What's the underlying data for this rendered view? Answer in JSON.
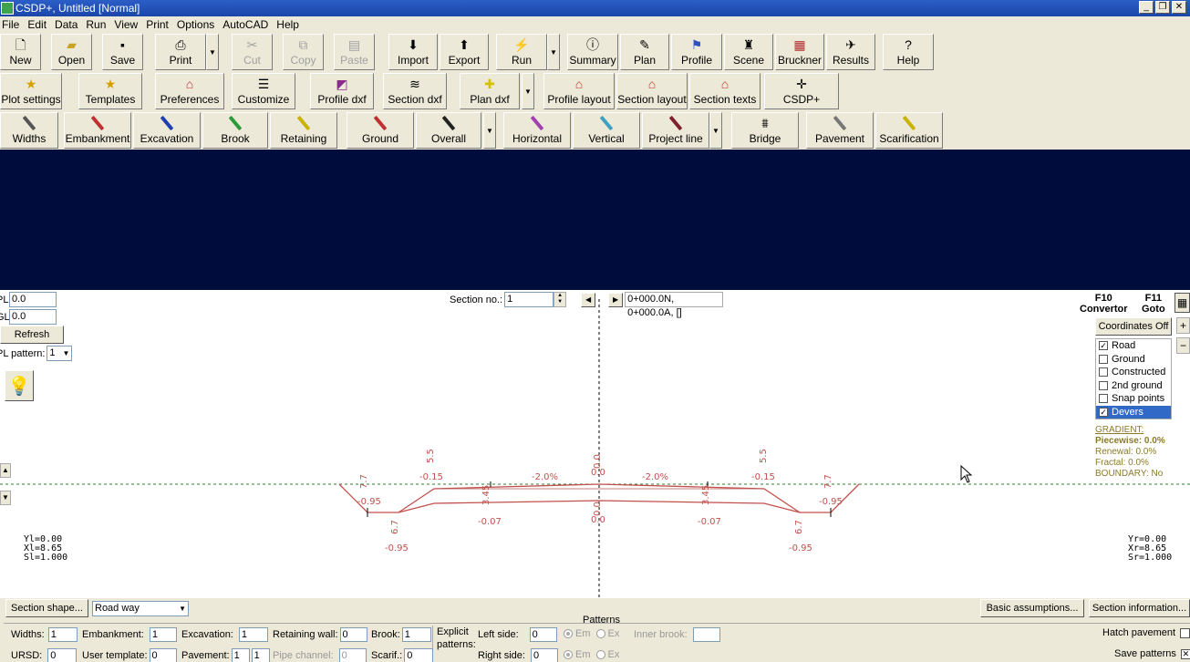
{
  "window": {
    "title": "CSDP+, Untitled [Normal]"
  },
  "menu": [
    "File",
    "Edit",
    "Data",
    "Run",
    "View",
    "Print",
    "Options",
    "AutoCAD",
    "Help"
  ],
  "toolbar1": {
    "new": "New",
    "open": "Open",
    "save": "Save",
    "print": "Print",
    "cut": "Cut",
    "copy": "Copy",
    "paste": "Paste",
    "import": "Import",
    "export": "Export",
    "run": "Run",
    "summary": "Summary",
    "plan": "Plan",
    "profile": "Profile",
    "scene": "Scene",
    "bruckner": "Bruckner",
    "results": "Results",
    "help": "Help"
  },
  "toolbar2": {
    "plot_settings": "Plot settings",
    "templates": "Templates",
    "preferences": "Preferences",
    "customize": "Customize",
    "profile_dxf": "Profile dxf",
    "section_dxf": "Section dxf",
    "plan_dxf": "Plan dxf",
    "profile_layout": "Profile layout",
    "section_layout": "Section layout",
    "section_texts": "Section texts",
    "csdp_plus": "CSDP+"
  },
  "toolbar3": {
    "widths": "Widths",
    "embankment": "Embankment",
    "excavation": "Excavation",
    "brook": "Brook",
    "retaining": "Retaining",
    "ground": "Ground",
    "overall": "Overall",
    "horizontal": "Horizontal",
    "vertical": "Vertical",
    "project_line": "Project line",
    "bridge": "Bridge",
    "pavement": "Pavement",
    "scarification": "Scarification"
  },
  "canvas": {
    "pl_label": "PL:",
    "pl_value": "0.0",
    "gl_label": "GL:",
    "gl_value": "0.0",
    "refresh": "Refresh",
    "pl_pattern_label": "PL pattern:",
    "pl_pattern_value": "1",
    "section_no_label": "Section no.:",
    "section_no_value": "1",
    "station_text": "0+000.0N, 0+000.0A, []",
    "f10": "F10",
    "convertor": "Convertor",
    "f11": "F11",
    "goto": "Goto",
    "coordinates_off": "Coordinates Off",
    "plus": "+",
    "minus": "−",
    "layers": [
      {
        "label": "Road",
        "checked": "✓"
      },
      {
        "label": "Ground",
        "checked": ""
      },
      {
        "label": "Constructed",
        "checked": ""
      },
      {
        "label": "2nd ground",
        "checked": ""
      },
      {
        "label": "Snap points",
        "checked": ""
      },
      {
        "label": "Devers",
        "checked": "✓"
      }
    ],
    "gradient": {
      "header": "GRADIENT:",
      "piecewise": "Piecewise:  0.0%",
      "renewal": "Renewal:  0.0%",
      "fractal": "Fractal:  0.0%",
      "boundary": "BOUNDARY: No"
    },
    "left_coords": [
      "Yl=0.00",
      "Xl=8.65",
      "Sl=1.000"
    ],
    "right_coords": [
      "Yr=0.00",
      "Xr=8.65",
      "Sr=1.000"
    ],
    "labels": {
      "l_5_5": "5.5",
      "l_m015_l": "-0.15",
      "l_m2_l": "-2.0%",
      "l_00_top": "0.0",
      "l_00_top2": "0.0",
      "l_m2_r": "-2.0%",
      "r_5_5": "5.5",
      "l_m015_r": "-0.15",
      "l_7_l": "7.7",
      "l_m095_l1": "-0.95",
      "l_345_l": "3.45",
      "l_m007_l": "-0.07",
      "l_345_r": "3.45",
      "l_m007_r": "-0.07",
      "l_7_r": "7.7",
      "l_m095_r1": "-0.95",
      "l_67_l": "6.7",
      "l_m095_l2": "-0.95",
      "l_67_r": "6.7",
      "l_m095_r2": "-0.95",
      "l_00_bot": "0.0",
      "l_00_bot2": "0.0"
    },
    "colors": {
      "section_line": "#c0504d",
      "ground_line": "#2e7d32",
      "axis": "#000000"
    }
  },
  "bottom": {
    "section_shape": "Section shape...",
    "road_way": "Road way",
    "patterns": "Patterns",
    "basic_assumptions": "Basic assumptions...",
    "section_information": "Section information...",
    "widths_label": "Widths:",
    "widths_value": "1",
    "embankment_label": "Embankment:",
    "embankment_value": "1",
    "excavation_label": "Excavation:",
    "excavation_value": "1",
    "retaining_label": "Retaining wall:",
    "retaining_value": "0",
    "brook_label": "Brook:",
    "brook_value": "1",
    "explicit_patterns": "Explicit patterns:",
    "left_side_label": "Left side:",
    "left_side_value": "0",
    "right_side_label": "Right side:",
    "right_side_value": "0",
    "em": "Em",
    "ex": "Ex",
    "inner_brook_label": "Inner brook:",
    "hatch_pavement": "Hatch pavement",
    "save_patterns": "Save patterns",
    "ursd_label": "URSD:",
    "ursd_value": "0",
    "user_template_label": "User template:",
    "user_template_value": "0",
    "pavement_label": "Pavement:",
    "pavement_value": "1",
    "pavement_value2": "1",
    "pipe_channel_label": "Pipe channel:",
    "pipe_channel_value": "0",
    "scarif_label": "Scarif.:",
    "scarif_value": "0"
  }
}
